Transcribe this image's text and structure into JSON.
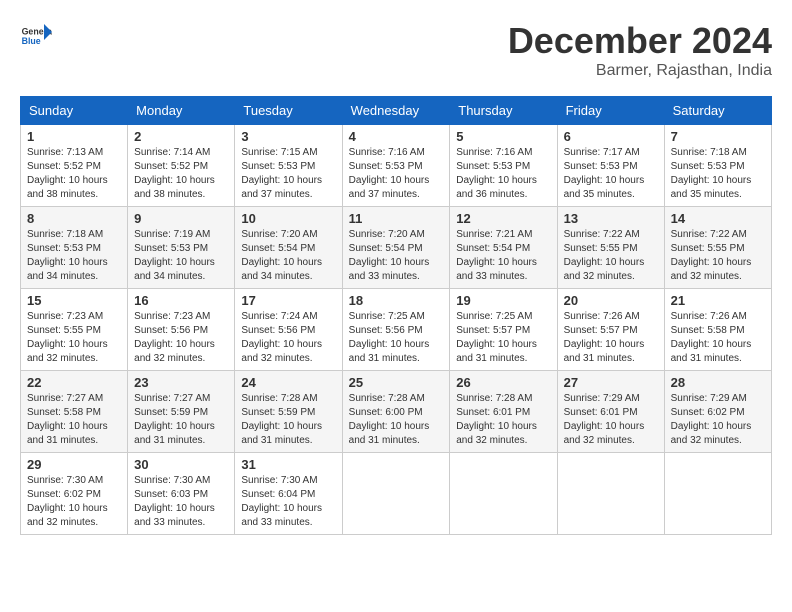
{
  "header": {
    "logo": {
      "general": "General",
      "blue": "Blue"
    },
    "month": "December 2024",
    "location": "Barmer, Rajasthan, India"
  },
  "weekdays": [
    "Sunday",
    "Monday",
    "Tuesday",
    "Wednesday",
    "Thursday",
    "Friday",
    "Saturday"
  ],
  "weeks": [
    [
      {
        "day": "1",
        "info": "Sunrise: 7:13 AM\nSunset: 5:52 PM\nDaylight: 10 hours\nand 38 minutes."
      },
      {
        "day": "2",
        "info": "Sunrise: 7:14 AM\nSunset: 5:52 PM\nDaylight: 10 hours\nand 38 minutes."
      },
      {
        "day": "3",
        "info": "Sunrise: 7:15 AM\nSunset: 5:53 PM\nDaylight: 10 hours\nand 37 minutes."
      },
      {
        "day": "4",
        "info": "Sunrise: 7:16 AM\nSunset: 5:53 PM\nDaylight: 10 hours\nand 37 minutes."
      },
      {
        "day": "5",
        "info": "Sunrise: 7:16 AM\nSunset: 5:53 PM\nDaylight: 10 hours\nand 36 minutes."
      },
      {
        "day": "6",
        "info": "Sunrise: 7:17 AM\nSunset: 5:53 PM\nDaylight: 10 hours\nand 35 minutes."
      },
      {
        "day": "7",
        "info": "Sunrise: 7:18 AM\nSunset: 5:53 PM\nDaylight: 10 hours\nand 35 minutes."
      }
    ],
    [
      {
        "day": "8",
        "info": "Sunrise: 7:18 AM\nSunset: 5:53 PM\nDaylight: 10 hours\nand 34 minutes."
      },
      {
        "day": "9",
        "info": "Sunrise: 7:19 AM\nSunset: 5:53 PM\nDaylight: 10 hours\nand 34 minutes."
      },
      {
        "day": "10",
        "info": "Sunrise: 7:20 AM\nSunset: 5:54 PM\nDaylight: 10 hours\nand 34 minutes."
      },
      {
        "day": "11",
        "info": "Sunrise: 7:20 AM\nSunset: 5:54 PM\nDaylight: 10 hours\nand 33 minutes."
      },
      {
        "day": "12",
        "info": "Sunrise: 7:21 AM\nSunset: 5:54 PM\nDaylight: 10 hours\nand 33 minutes."
      },
      {
        "day": "13",
        "info": "Sunrise: 7:22 AM\nSunset: 5:55 PM\nDaylight: 10 hours\nand 32 minutes."
      },
      {
        "day": "14",
        "info": "Sunrise: 7:22 AM\nSunset: 5:55 PM\nDaylight: 10 hours\nand 32 minutes."
      }
    ],
    [
      {
        "day": "15",
        "info": "Sunrise: 7:23 AM\nSunset: 5:55 PM\nDaylight: 10 hours\nand 32 minutes."
      },
      {
        "day": "16",
        "info": "Sunrise: 7:23 AM\nSunset: 5:56 PM\nDaylight: 10 hours\nand 32 minutes."
      },
      {
        "day": "17",
        "info": "Sunrise: 7:24 AM\nSunset: 5:56 PM\nDaylight: 10 hours\nand 32 minutes."
      },
      {
        "day": "18",
        "info": "Sunrise: 7:25 AM\nSunset: 5:56 PM\nDaylight: 10 hours\nand 31 minutes."
      },
      {
        "day": "19",
        "info": "Sunrise: 7:25 AM\nSunset: 5:57 PM\nDaylight: 10 hours\nand 31 minutes."
      },
      {
        "day": "20",
        "info": "Sunrise: 7:26 AM\nSunset: 5:57 PM\nDaylight: 10 hours\nand 31 minutes."
      },
      {
        "day": "21",
        "info": "Sunrise: 7:26 AM\nSunset: 5:58 PM\nDaylight: 10 hours\nand 31 minutes."
      }
    ],
    [
      {
        "day": "22",
        "info": "Sunrise: 7:27 AM\nSunset: 5:58 PM\nDaylight: 10 hours\nand 31 minutes."
      },
      {
        "day": "23",
        "info": "Sunrise: 7:27 AM\nSunset: 5:59 PM\nDaylight: 10 hours\nand 31 minutes."
      },
      {
        "day": "24",
        "info": "Sunrise: 7:28 AM\nSunset: 5:59 PM\nDaylight: 10 hours\nand 31 minutes."
      },
      {
        "day": "25",
        "info": "Sunrise: 7:28 AM\nSunset: 6:00 PM\nDaylight: 10 hours\nand 31 minutes."
      },
      {
        "day": "26",
        "info": "Sunrise: 7:28 AM\nSunset: 6:01 PM\nDaylight: 10 hours\nand 32 minutes."
      },
      {
        "day": "27",
        "info": "Sunrise: 7:29 AM\nSunset: 6:01 PM\nDaylight: 10 hours\nand 32 minutes."
      },
      {
        "day": "28",
        "info": "Sunrise: 7:29 AM\nSunset: 6:02 PM\nDaylight: 10 hours\nand 32 minutes."
      }
    ],
    [
      {
        "day": "29",
        "info": "Sunrise: 7:30 AM\nSunset: 6:02 PM\nDaylight: 10 hours\nand 32 minutes."
      },
      {
        "day": "30",
        "info": "Sunrise: 7:30 AM\nSunset: 6:03 PM\nDaylight: 10 hours\nand 33 minutes."
      },
      {
        "day": "31",
        "info": "Sunrise: 7:30 AM\nSunset: 6:04 PM\nDaylight: 10 hours\nand 33 minutes."
      },
      null,
      null,
      null,
      null
    ]
  ]
}
